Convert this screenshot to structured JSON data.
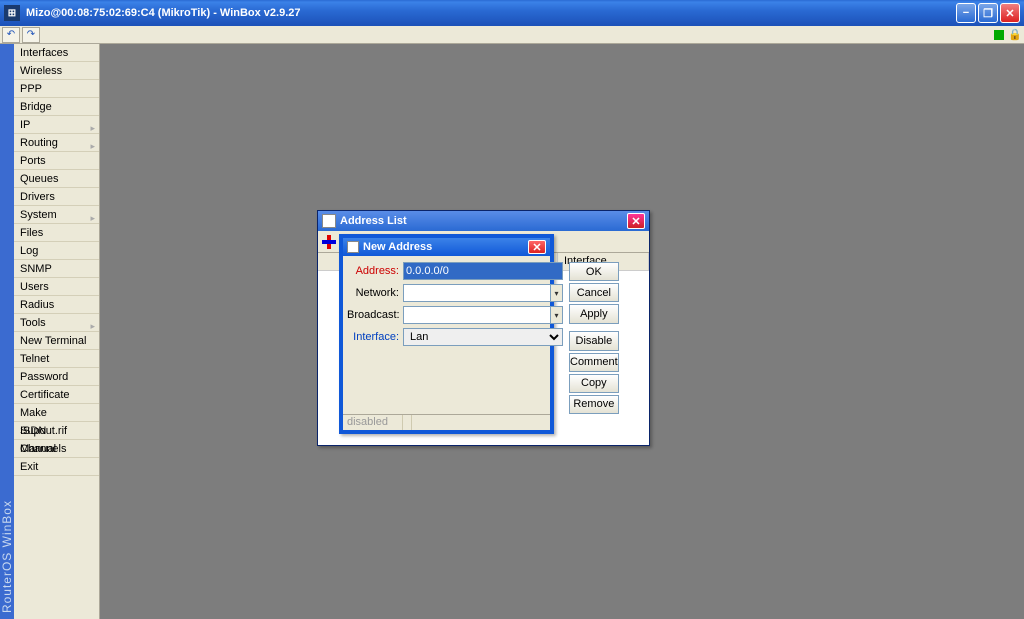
{
  "app": {
    "title": "Mizo@00:08:75:02:69:C4 (MikroTik) - WinBox v2.9.27",
    "icon_glyph": "⊞"
  },
  "toolbar": {
    "undo_glyph": "↶",
    "redo_glyph": "↷",
    "lock_glyph": "🔒"
  },
  "vertical_label": "RouterOS WinBox",
  "sidebar": {
    "items": [
      {
        "label": "Interfaces",
        "sub": false
      },
      {
        "label": "Wireless",
        "sub": false
      },
      {
        "label": "PPP",
        "sub": false
      },
      {
        "label": "Bridge",
        "sub": false
      },
      {
        "label": "IP",
        "sub": true
      },
      {
        "label": "Routing",
        "sub": true
      },
      {
        "label": "Ports",
        "sub": false
      },
      {
        "label": "Queues",
        "sub": false
      },
      {
        "label": "Drivers",
        "sub": false
      },
      {
        "label": "System",
        "sub": true
      },
      {
        "label": "Files",
        "sub": false
      },
      {
        "label": "Log",
        "sub": false
      },
      {
        "label": "SNMP",
        "sub": false
      },
      {
        "label": "Users",
        "sub": false
      },
      {
        "label": "Radius",
        "sub": false
      },
      {
        "label": "Tools",
        "sub": true
      },
      {
        "label": "New Terminal",
        "sub": false
      },
      {
        "label": "Telnet",
        "sub": false
      },
      {
        "label": "Password",
        "sub": false
      },
      {
        "label": "Certificate",
        "sub": false
      },
      {
        "label": "Make Supout.rif",
        "sub": false
      },
      {
        "label": "ISDN Channels",
        "sub": false
      },
      {
        "label": "Manual",
        "sub": false
      },
      {
        "label": "Exit",
        "sub": false
      }
    ]
  },
  "address_list": {
    "title": "Address List",
    "columns": {
      "interface": "Interface"
    }
  },
  "new_address": {
    "title": "New Address",
    "labels": {
      "address": "Address:",
      "network": "Network:",
      "broadcast": "Broadcast:",
      "interface": "Interface:"
    },
    "values": {
      "address": "0.0.0.0/0",
      "network": "",
      "broadcast": "",
      "interface": "Lan"
    },
    "buttons": {
      "ok": "OK",
      "cancel": "Cancel",
      "apply": "Apply",
      "disable": "Disable",
      "comment": "Comment",
      "copy": "Copy",
      "remove": "Remove"
    },
    "status": "disabled"
  }
}
